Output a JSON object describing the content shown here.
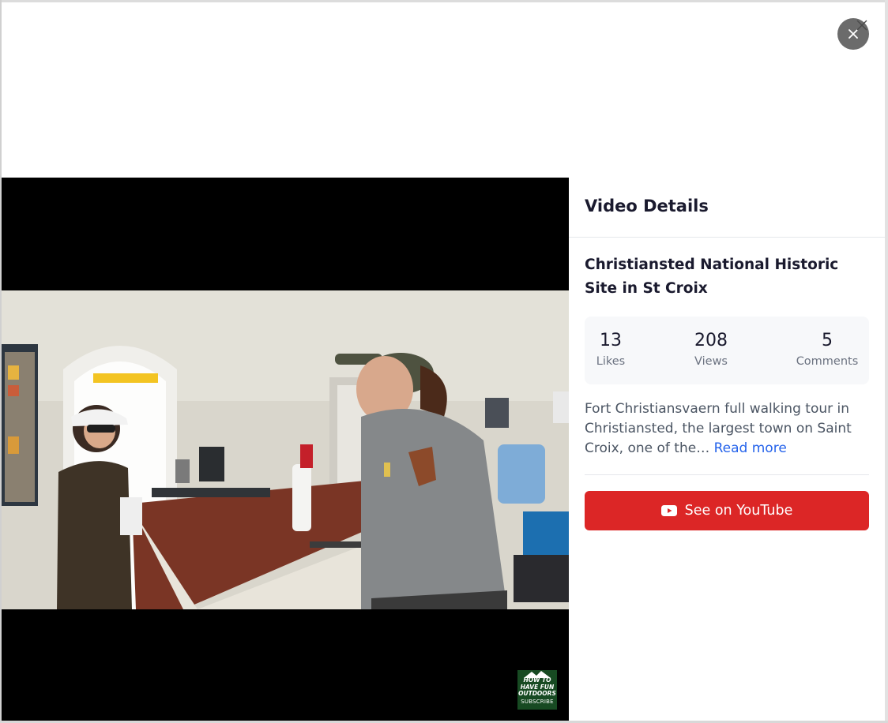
{
  "modal": {
    "close_icon": "close-icon"
  },
  "video": {
    "watermark": {
      "line1": "HOW TO",
      "line2": "HAVE FUN",
      "line3": "OUTDOORS",
      "line4": "SUBSCRIBE"
    }
  },
  "details": {
    "heading": "Video Details",
    "title": "Christiansted National Historic Site in St Croix",
    "stats": [
      {
        "value": "13",
        "label": "Likes"
      },
      {
        "value": "208",
        "label": "Views"
      },
      {
        "value": "5",
        "label": "Comments"
      }
    ],
    "description": "Fort Christiansvaern full walking tour in Christiansted, the largest town on Saint Croix, one of the…",
    "read_more": "Read more",
    "youtube_button": "See on YouTube",
    "youtube_icon": "youtube-icon"
  },
  "colors": {
    "accent_red": "#dc2626",
    "link_blue": "#2563eb"
  }
}
